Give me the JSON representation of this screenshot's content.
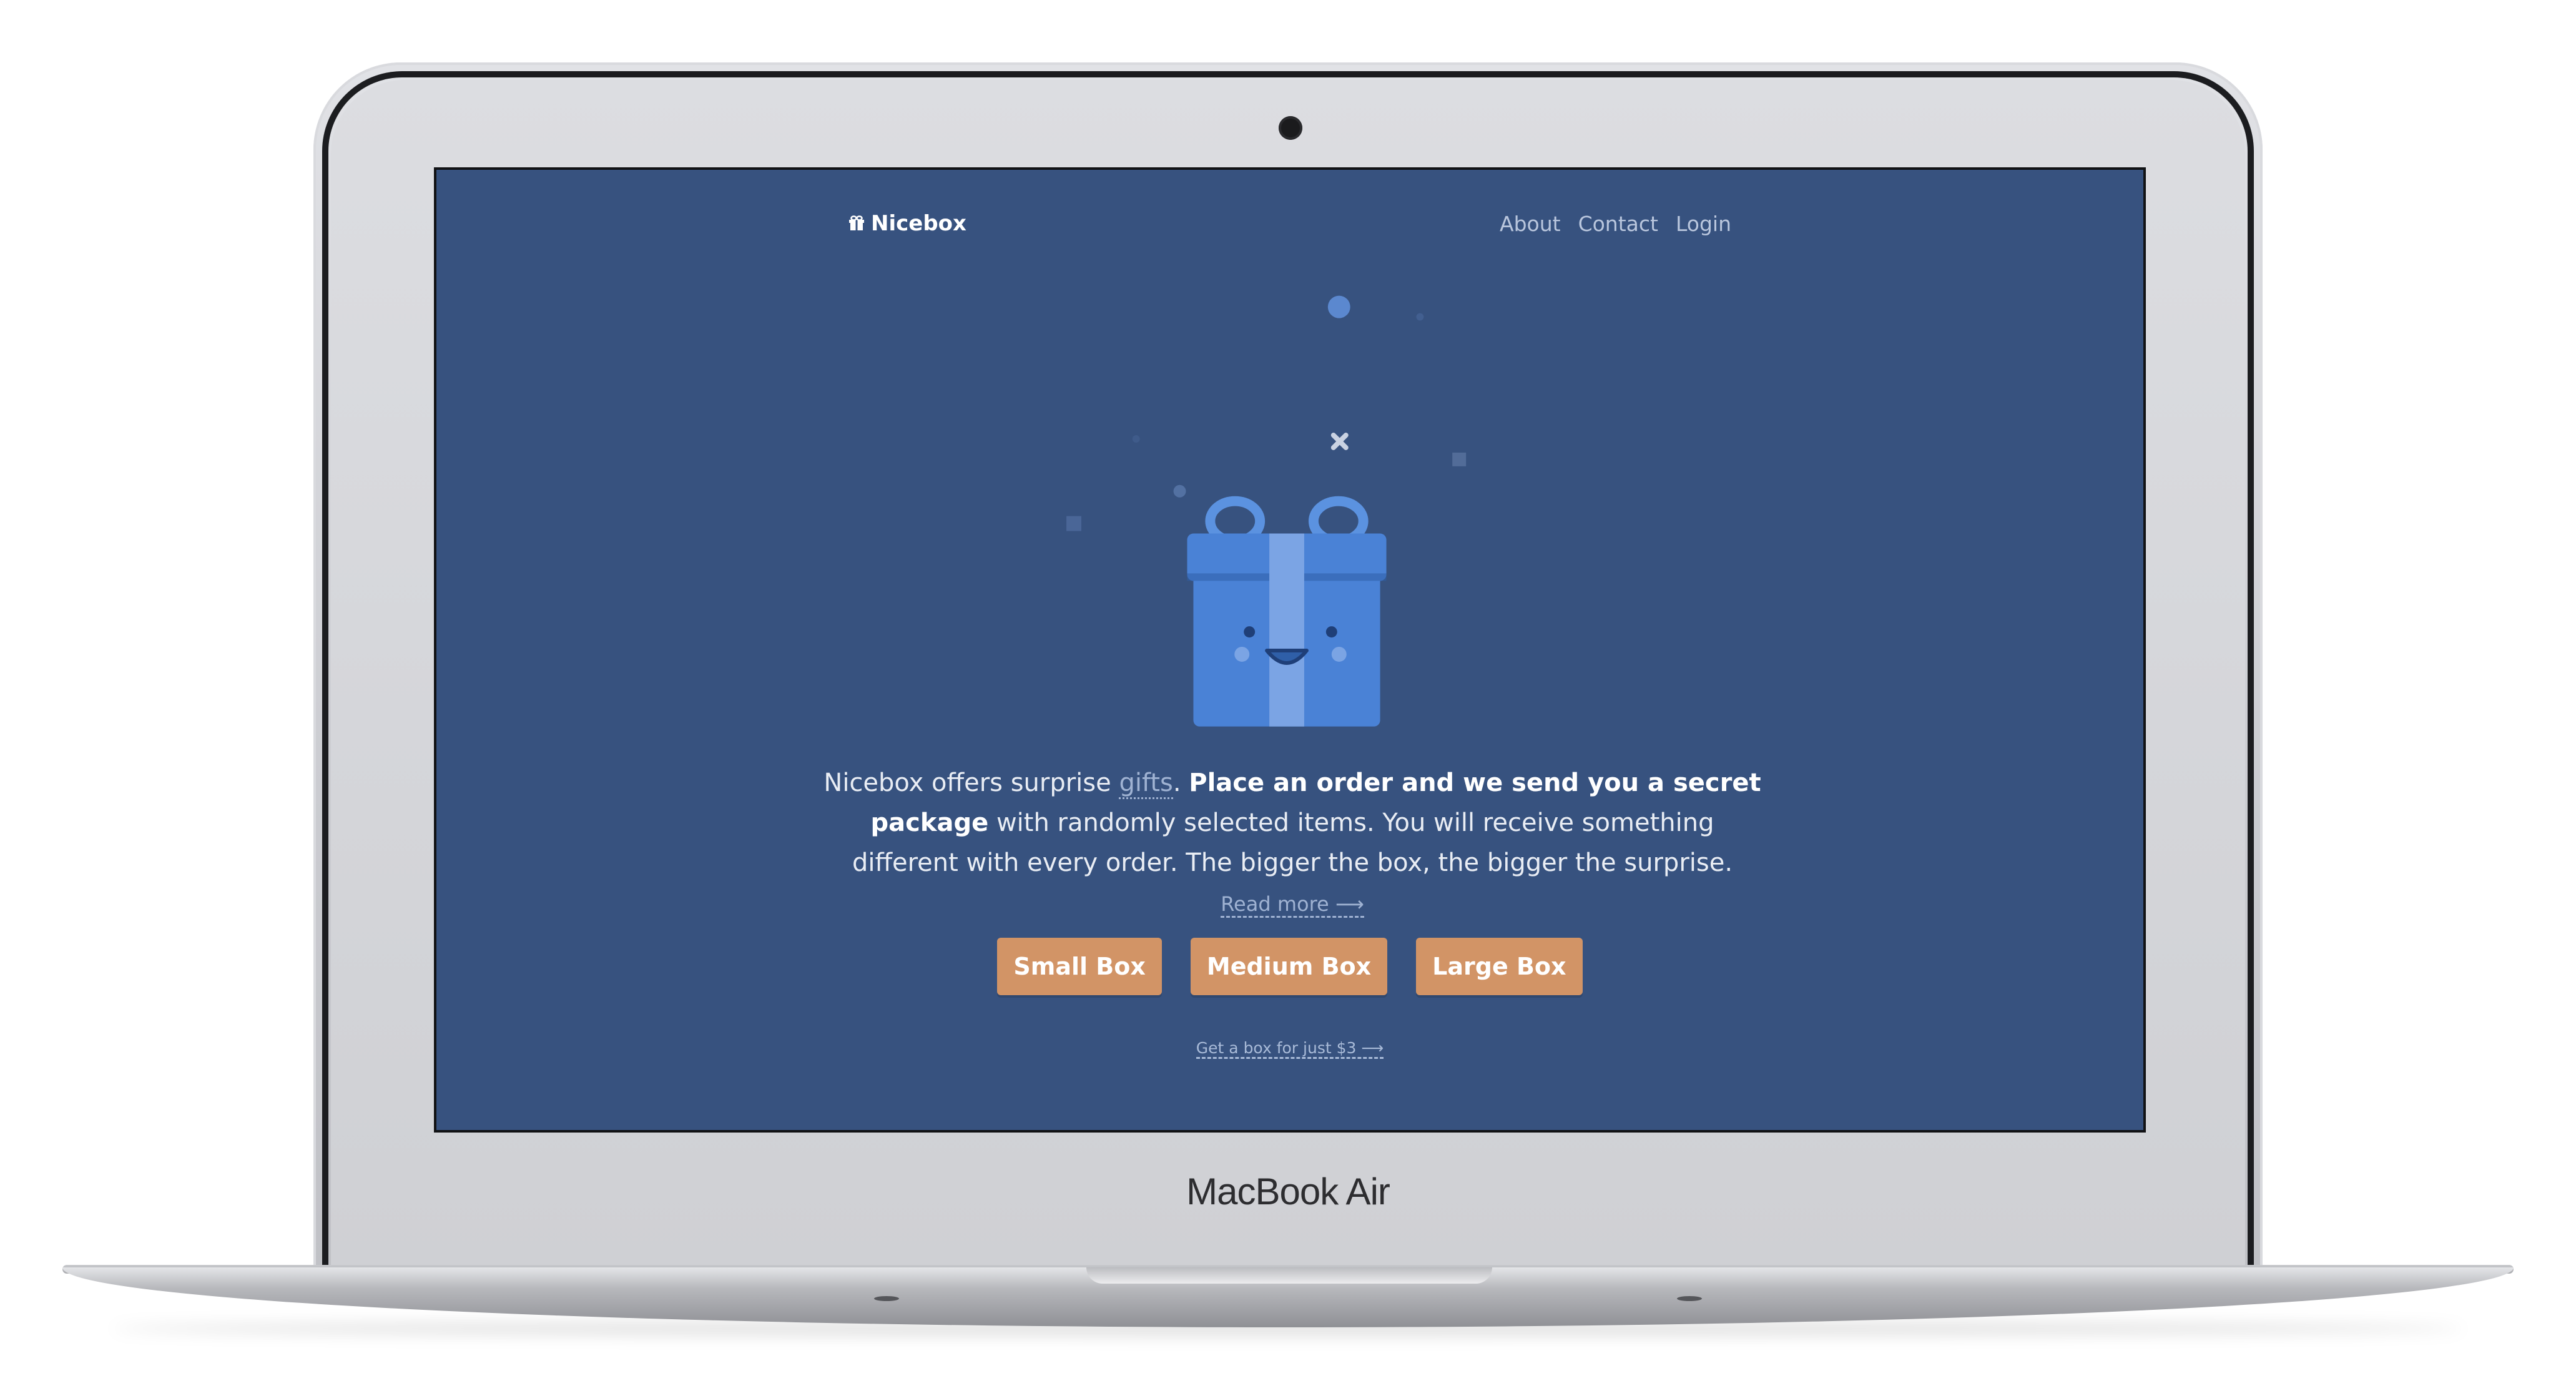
{
  "device": {
    "brand_label": "MacBook Air"
  },
  "nav": {
    "logo_text": "Nicebox",
    "links": [
      "About",
      "Contact",
      "Login"
    ]
  },
  "hero": {
    "icon": "smiling-gift-box",
    "intro_lead": "Nicebox offers surprise ",
    "intro_link": "gifts",
    "intro_after_link": ". ",
    "intro_bold": "Place an order and we send you a secret package",
    "intro_rest": " with randomly selected items. You will receive something different with every order. The bigger the box, the bigger the surprise. ",
    "read_more": "Read more ⟶"
  },
  "buttons": [
    "Small Box",
    "Medium Box",
    "Large Box"
  ],
  "cta_small": "Get a box for just $3 ⟶",
  "colors": {
    "screen_background": "#37527f",
    "button": "#d29466",
    "gift_blue": "#4a82d6",
    "gift_dark": "#2f5fa8",
    "gift_light": "#7ba4e4"
  }
}
